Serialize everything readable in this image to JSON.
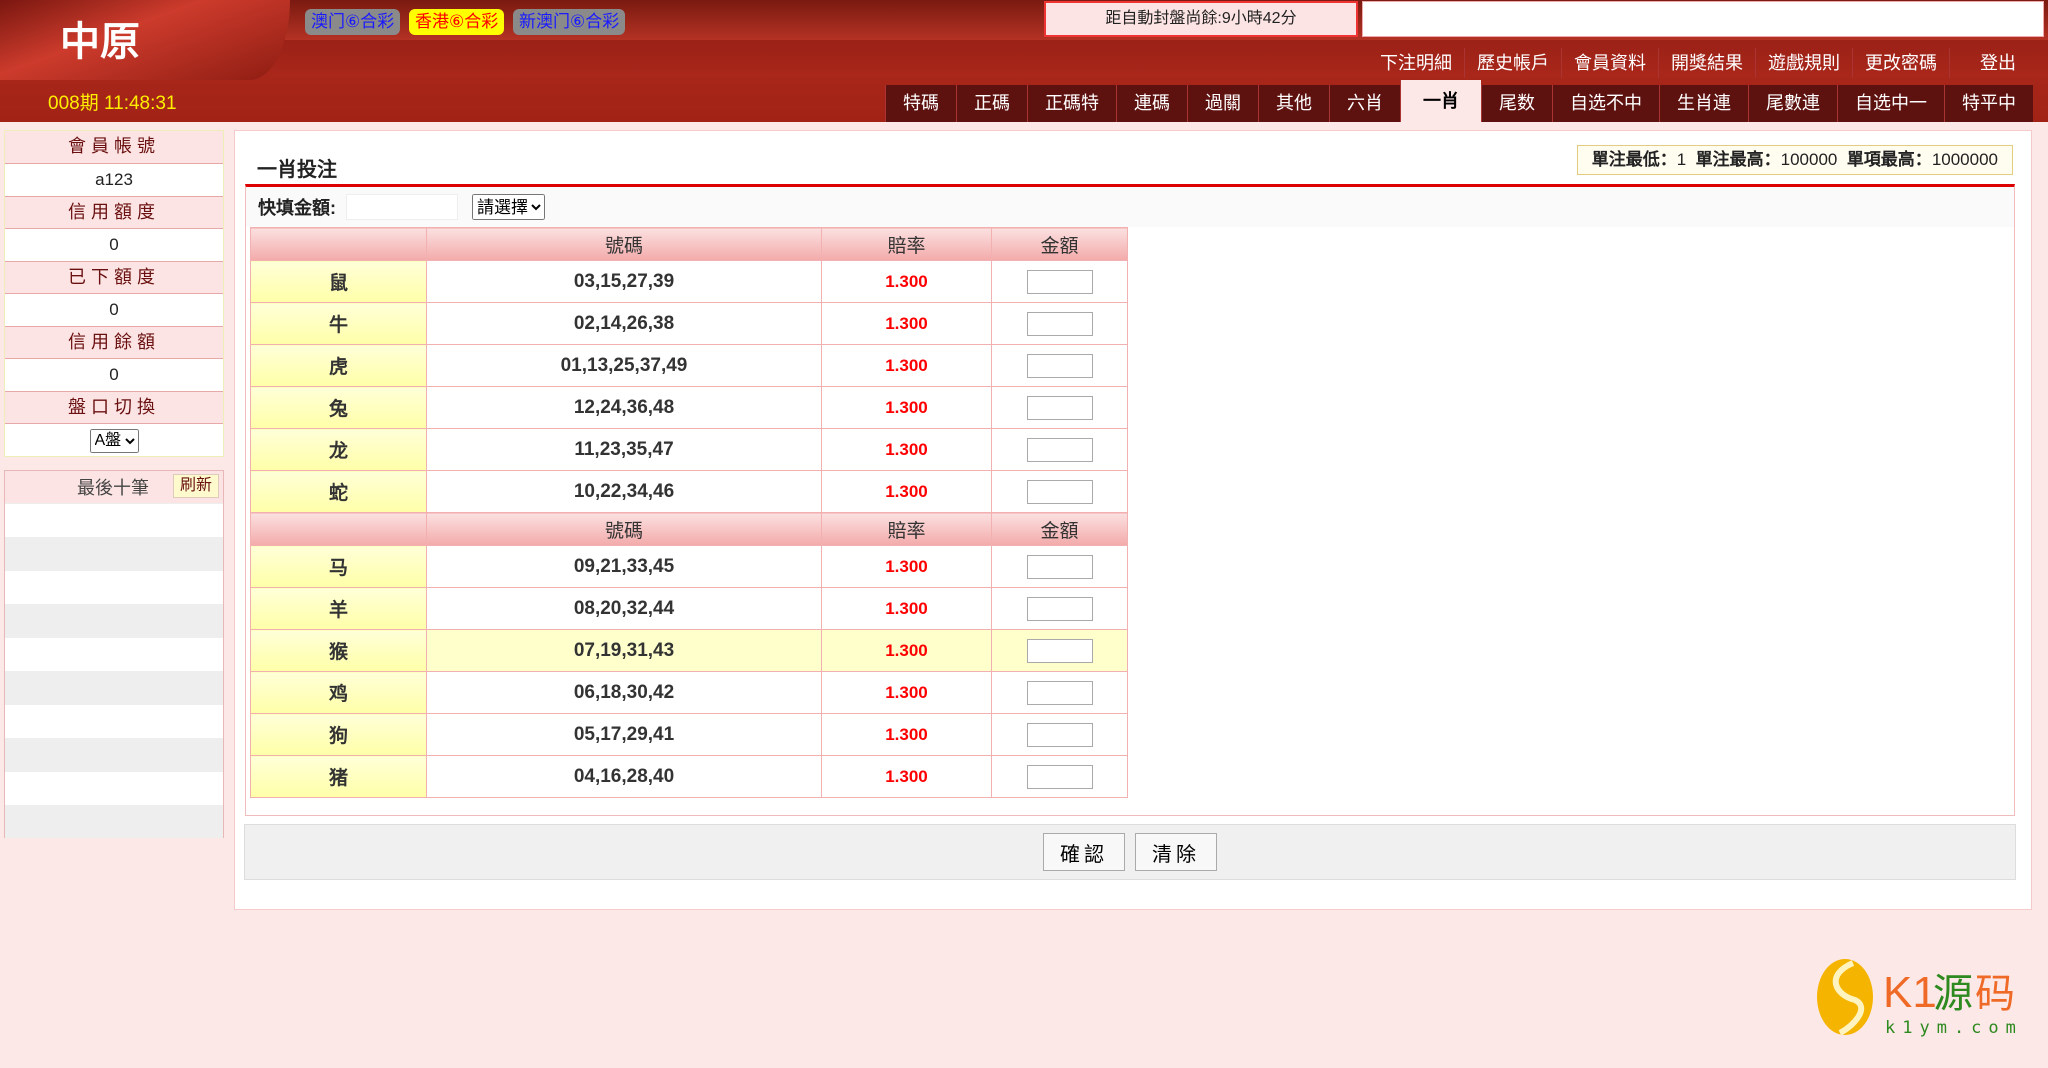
{
  "header": {
    "logo": "中原",
    "lotteries": [
      "澳门⑥合彩",
      "香港⑥合彩",
      "新澳门⑥合彩"
    ],
    "active_lottery": 1,
    "countdown": "距自動封盤尚餘:9小時42分",
    "period": "008期 11:48:31",
    "nav": [
      "下注明細",
      "歷史帳戶",
      "會員資料",
      "開獎結果",
      "遊戲規則",
      "更改密碼",
      "登出"
    ],
    "tabs": [
      "特碼",
      "正碼",
      "正碼特",
      "連碼",
      "過關",
      "其他",
      "六肖",
      "一肖",
      "尾数",
      "自选不中",
      "生肖連",
      "尾數連",
      "自选中一",
      "特平中"
    ],
    "active_tab": 7
  },
  "sidebar": {
    "account_label": "會員帳號",
    "account": "a123",
    "credit_label": "信用額度",
    "credit": "0",
    "used_label": "已下額度",
    "used": "0",
    "balance_label": "信用餘額",
    "balance": "0",
    "plate_label": "盤口切換",
    "plate": "A盤",
    "last_label": "最後十筆",
    "refresh": "刷新"
  },
  "main": {
    "title": "一肖投注",
    "limits": {
      "min_label": "單注最低：",
      "min": "1",
      "max_label": "單注最高：",
      "max": "100000",
      "item_label": "單項最高：",
      "item": "1000000"
    },
    "quick_label": "快填金額:",
    "quick_select": "請選擇",
    "headers": [
      "號碼",
      "賠率",
      "金額"
    ],
    "groups": [
      [
        {
          "z": "鼠",
          "n": "03,15,27,39",
          "o": "1.300"
        },
        {
          "z": "牛",
          "n": "02,14,26,38",
          "o": "1.300"
        },
        {
          "z": "虎",
          "n": "01,13,25,37,49",
          "o": "1.300"
        },
        {
          "z": "兔",
          "n": "12,24,36,48",
          "o": "1.300"
        },
        {
          "z": "龙",
          "n": "11,23,35,47",
          "o": "1.300"
        },
        {
          "z": "蛇",
          "n": "10,22,34,46",
          "o": "1.300"
        }
      ],
      [
        {
          "z": "马",
          "n": "09,21,33,45",
          "o": "1.300"
        },
        {
          "z": "羊",
          "n": "08,20,32,44",
          "o": "1.300"
        },
        {
          "z": "猴",
          "n": "07,19,31,43",
          "o": "1.300"
        },
        {
          "z": "鸡",
          "n": "06,18,30,42",
          "o": "1.300"
        },
        {
          "z": "狗",
          "n": "05,17,29,41",
          "o": "1.300"
        },
        {
          "z": "猪",
          "n": "04,16,28,40",
          "o": "1.300"
        }
      ]
    ],
    "highlight_row": "猴",
    "confirm": "確認",
    "clear": "清除"
  },
  "watermark": {
    "brand": "K1源码",
    "url": "k1ym.com"
  }
}
